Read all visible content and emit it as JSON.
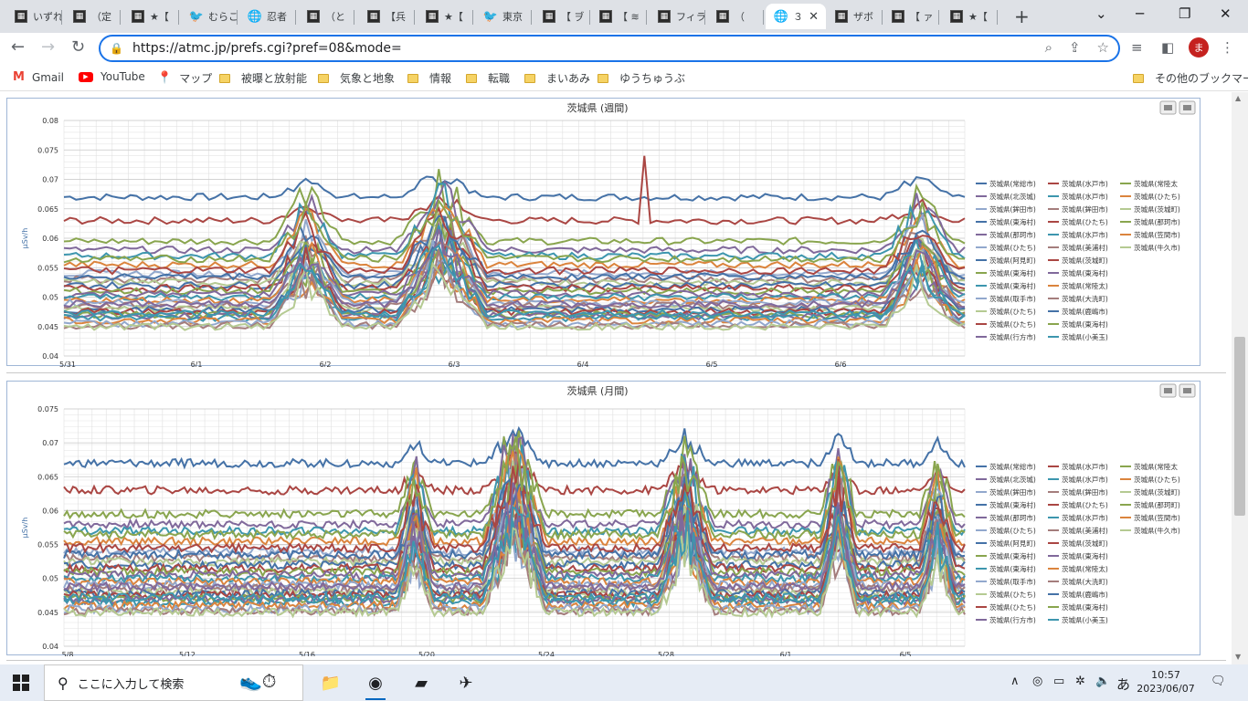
{
  "browser": {
    "tabs": [
      {
        "label": "いずれ",
        "icon": "dark"
      },
      {
        "label": "（定",
        "icon": "dark"
      },
      {
        "label": "★【",
        "icon": "dark"
      },
      {
        "label": "むらこ",
        "icon": "bird"
      },
      {
        "label": "忍者",
        "icon": "globe"
      },
      {
        "label": "（と",
        "icon": "dark"
      },
      {
        "label": "【兵",
        "icon": "dark"
      },
      {
        "label": "★【",
        "icon": "dark"
      },
      {
        "label": "東京",
        "icon": "bird"
      },
      {
        "label": "【 ヺ",
        "icon": "dark"
      },
      {
        "label": "【 ≋",
        "icon": "dark"
      },
      {
        "label": "フィラ",
        "icon": "dark"
      },
      {
        "label": "（",
        "icon": "dark"
      },
      {
        "label": "３",
        "icon": "globe",
        "active": true
      },
      {
        "label": "ザボ",
        "icon": "dark"
      },
      {
        "label": "【 ァ",
        "icon": "dark"
      },
      {
        "label": "★【",
        "icon": "dark"
      }
    ],
    "url": "https://atmc.jp/prefs.cgi?pref=08&mode=",
    "avatar_letter": "ま",
    "bookmarks": [
      {
        "label": "Gmail",
        "icon": "gmail-icon"
      },
      {
        "label": "YouTube",
        "icon": "youtube-icon"
      },
      {
        "label": "マップ",
        "icon": "maps-icon"
      },
      {
        "label": "被曝と放射能",
        "icon": "folder-icon"
      },
      {
        "label": "気象と地象",
        "icon": "folder-icon"
      },
      {
        "label": "情報",
        "icon": "folder-icon"
      },
      {
        "label": "転職",
        "icon": "folder-icon"
      },
      {
        "label": "まいあみ",
        "icon": "folder-icon"
      },
      {
        "label": "ゆうちゅうぶ",
        "icon": "folder-icon"
      }
    ],
    "other_bookmarks": "その他のブックマーク"
  },
  "taskbar": {
    "search_placeholder": "ここに入力して検索",
    "time": "10:57",
    "date": "2023/06/07",
    "ime": "あ"
  },
  "chart_data": [
    {
      "type": "line",
      "title": "茨城県 (週間)",
      "ylabel": "μSv/h",
      "ylim": [
        0.04,
        0.08
      ],
      "yticks": [
        "0.08",
        "0.075",
        "0.07",
        "0.065",
        "0.06",
        "0.055",
        "0.05",
        "0.045",
        "0.04"
      ],
      "xticks": [
        "5/31",
        "6/1",
        "6/2",
        "6/3",
        "6/4",
        "6/5",
        "6/6"
      ],
      "grid": true,
      "legend": "right",
      "legend_labels": [
        "茨城県(常総市)",
        "茨城県(水戸市)",
        "茨城県(常陸太",
        "茨城県(北茨城)",
        "茨城県(水戸市)",
        "茨城県(ひたち)",
        "茨城県(鉾田市)",
        "茨城県(鉾田市)",
        "茨城県(茨城町)",
        "茨城県(東海村)",
        "茨城県(ひたち)",
        "茨城県(那珂市)",
        "茨城県(那珂市)",
        "茨城県(水戸市)",
        "茨城県(笠間市)",
        "茨城県(ひたち)",
        "茨城県(美浦村)",
        "茨城県(牛久市)",
        "茨城県(阿見町)",
        "茨城県(茨城町)",
        "茨城県(東海村)",
        "茨城県(東海村)",
        "茨城県(東海村)",
        "茨城県(常陸太)",
        "茨城県(取手市)",
        "茨城県(大洗町)",
        "茨城県(ひたち)",
        "茨城県(鹿嶋市)",
        "茨城県(ひたち)",
        "茨城県(東海村)",
        "茨城県(行方市)",
        "茨城県(小美玉)"
      ],
      "series_hint": {
        "top_line_level": 0.067,
        "second_line_level": 0.063,
        "spike_value": 0.074,
        "bumps_at": [
          "6/2",
          "6/3",
          "6/6"
        ]
      }
    },
    {
      "type": "line",
      "title": "茨城県 (月間)",
      "ylabel": "μSv/h",
      "ylim": [
        0.04,
        0.075
      ],
      "yticks": [
        "0.075",
        "0.07",
        "0.065",
        "0.06",
        "0.055",
        "0.05",
        "0.045",
        "0.04"
      ],
      "xticks": [
        "5/8",
        "5/12",
        "5/16",
        "5/20",
        "5/24",
        "5/28",
        "6/1",
        "6/5"
      ],
      "grid": true,
      "legend": "right",
      "legend_labels": [
        "茨城県(常総市)",
        "茨城県(水戸市)",
        "茨城県(常陸太",
        "茨城県(北茨城)",
        "茨城県(水戸市)",
        "茨城県(ひたち)",
        "茨城県(鉾田市)",
        "茨城県(鉾田市)",
        "茨城県(茨城町)",
        "茨城県(東海村)",
        "茨城県(ひたち)",
        "茨城県(那珂町)",
        "茨城県(那珂市)",
        "茨城県(水戸市)",
        "茨城県(笠間市)",
        "茨城県(ひたち)",
        "茨城県(美浦村)",
        "茨城県(牛久市)",
        "茨城県(阿見町)",
        "茨城県(茨城町)",
        "茨城県(東海村)",
        "茨城県(東海村)",
        "茨城県(東海村)",
        "茨城県(常陸太)",
        "茨城県(取手市)",
        "茨城県(大洗町)",
        "茨城県(ひたち)",
        "茨城県(鹿嶋市)",
        "茨城県(ひたち)",
        "茨城県(東海村)",
        "茨城県(行方市)",
        "茨城県(小美玉)"
      ],
      "series_hint": {
        "top_line_level": 0.066,
        "second_line_level": 0.063,
        "bumps_at": [
          "5/20",
          "5/23",
          "5/28",
          "6/1",
          "6/6"
        ]
      }
    }
  ],
  "colors": {
    "series": [
      "#4572A7",
      "#AA4643",
      "#89A54E",
      "#80699B",
      "#3D96AE",
      "#DB843D",
      "#92A8CD",
      "#A47D7C",
      "#B5CA92"
    ],
    "panel_border": "#9fb6d6",
    "grid": "#d8d8d8"
  }
}
